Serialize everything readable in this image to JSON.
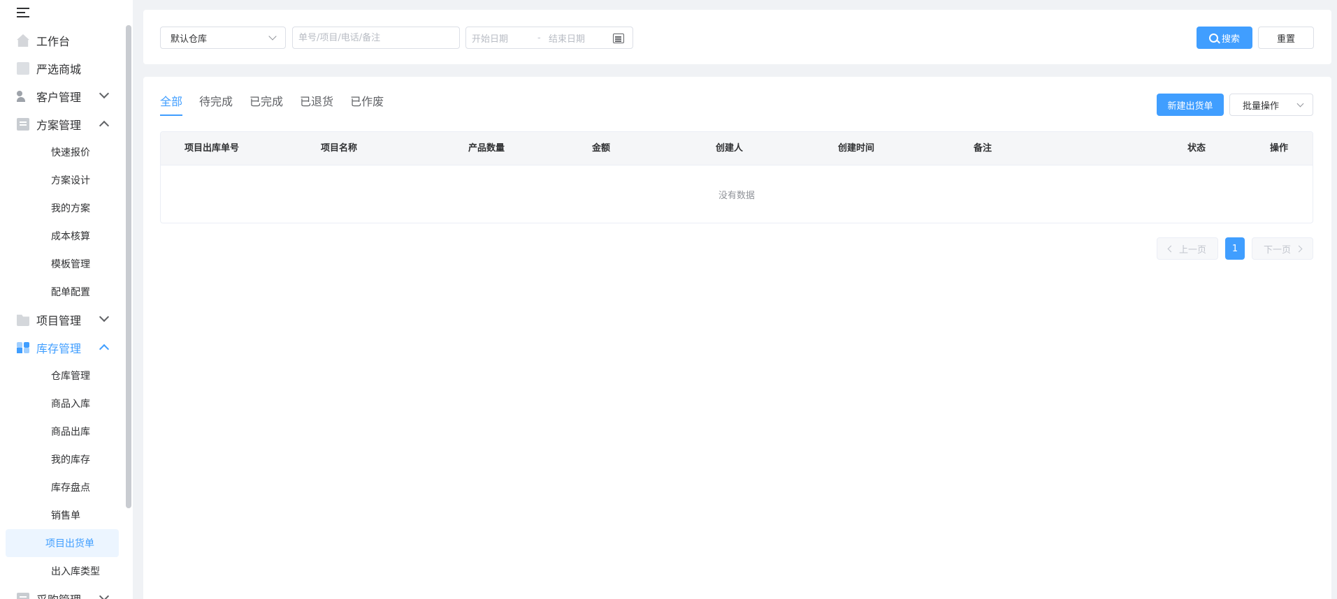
{
  "sidebar": {
    "menu": [
      {
        "label": "工作台",
        "icon": "home-icon"
      },
      {
        "label": "严选商城",
        "icon": "shop-icon"
      },
      {
        "label": "客户管理",
        "icon": "customer-icon"
      },
      {
        "label": "方案管理",
        "icon": "document-icon"
      },
      {
        "label": "项目管理",
        "icon": "folder-icon"
      },
      {
        "label": "库存管理",
        "icon": "stock-icon"
      },
      {
        "label": "采购管理",
        "icon": "purchase-icon"
      }
    ],
    "scheme_sub": [
      "快速报价",
      "方案设计",
      "我的方案",
      "成本核算",
      "模板管理",
      "配单配置"
    ],
    "stock_sub": [
      "仓库管理",
      "商品入库",
      "商品出库",
      "我的库存",
      "库存盘点",
      "销售单",
      "项目出货单",
      "出入库类型"
    ]
  },
  "filter": {
    "warehouse_value": "默认仓库",
    "search_placeholder": "单号/项目/电话/备注",
    "date_start_placeholder": "开始日期",
    "date_separator": "-",
    "date_end_placeholder": "结束日期",
    "search_label": "搜索",
    "reset_label": "重置"
  },
  "tabs": [
    "全部",
    "待完成",
    "已完成",
    "已退货",
    "已作废"
  ],
  "actions": {
    "new_label": "新建出货单",
    "batch_label": "批量操作"
  },
  "table": {
    "columns": [
      "项目出库单号",
      "项目名称",
      "产品数量",
      "金额",
      "创建人",
      "创建时间",
      "备注",
      "状态",
      "操作"
    ],
    "empty_text": "没有数据"
  },
  "pagination": {
    "prev_label": "上一页",
    "current_page": "1",
    "next_label": "下一页"
  },
  "colors": {
    "accent": "#409eff",
    "background": "#f0f2f5"
  }
}
